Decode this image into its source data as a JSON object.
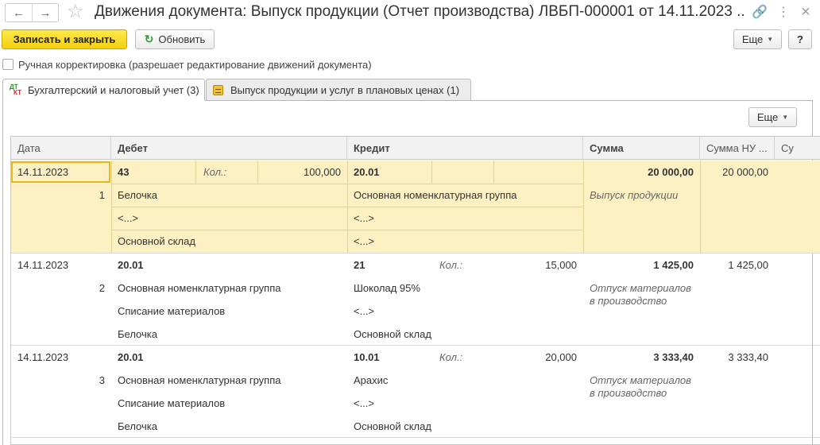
{
  "window": {
    "title": "Движения документа: Выпуск продукции (Отчет производства) ЛВБП-000001 от 14.11.2023 ..."
  },
  "icons": {
    "back": "←",
    "forward": "→",
    "star": "☆",
    "link": "🔗",
    "more": "⋮",
    "close": "×",
    "refresh": "↻",
    "caret": "▼"
  },
  "toolbar": {
    "save_close": "Записать и закрыть",
    "refresh": "Обновить",
    "more": "Еще",
    "help": "?"
  },
  "manual_edit": {
    "label": "Ручная корректировка (разрешает редактирование движений документа)"
  },
  "tabs": [
    {
      "label": "Бухгалтерский и налоговый учет (3)",
      "icon_top": "ДТ",
      "icon_bottom": "КТ"
    },
    {
      "label": "Выпуск продукции и услуг в плановых ценах (1)"
    }
  ],
  "table": {
    "more": "Еще",
    "columns": {
      "date": "Дата",
      "debit": "Дебет",
      "credit": "Кредит",
      "sum": "Сумма",
      "sum_nu": "Сумма НУ ...",
      "sum_extra": "Су"
    },
    "rows": [
      {
        "date": "14.11.2023",
        "num": "1",
        "dt_account": "43",
        "dt_qty_label": "Кол.:",
        "dt_qty": "100,000",
        "dt_sub": [
          "Белочка",
          "<...>",
          "Основной склад"
        ],
        "kt_account": "20.01",
        "kt_qty_label": "",
        "kt_qty": "",
        "kt_sub": [
          "Основная номенклатурная группа",
          "<...>",
          "<...>"
        ],
        "sum": "20 000,00",
        "sum_nu": "20 000,00",
        "content": "Выпуск продукции"
      },
      {
        "date": "14.11.2023",
        "num": "2",
        "dt_account": "20.01",
        "dt_qty_label": "",
        "dt_qty": "",
        "dt_sub": [
          "Основная номенклатурная группа",
          "Списание материалов",
          "Белочка"
        ],
        "kt_account": "21",
        "kt_qty_label": "Кол.:",
        "kt_qty": "15,000",
        "kt_sub": [
          "Шоколад 95%",
          "<...>",
          "Основной склад"
        ],
        "sum": "1 425,00",
        "sum_nu": "1 425,00",
        "content": "Отпуск материалов в производство"
      },
      {
        "date": "14.11.2023",
        "num": "3",
        "dt_account": "20.01",
        "dt_qty_label": "",
        "dt_qty": "",
        "dt_sub": [
          "Основная номенклатурная группа",
          "Списание материалов",
          "Белочка"
        ],
        "kt_account": "10.01",
        "kt_qty_label": "Кол.:",
        "kt_qty": "20,000",
        "kt_sub": [
          "Арахис",
          "<...>",
          "Основной склад"
        ],
        "sum": "3 333,40",
        "sum_nu": "3 333,40",
        "content": "Отпуск материалов в производство"
      }
    ]
  },
  "colors": {
    "selected_row": "#fdf1c4",
    "primary_button": "#f4cf10"
  }
}
